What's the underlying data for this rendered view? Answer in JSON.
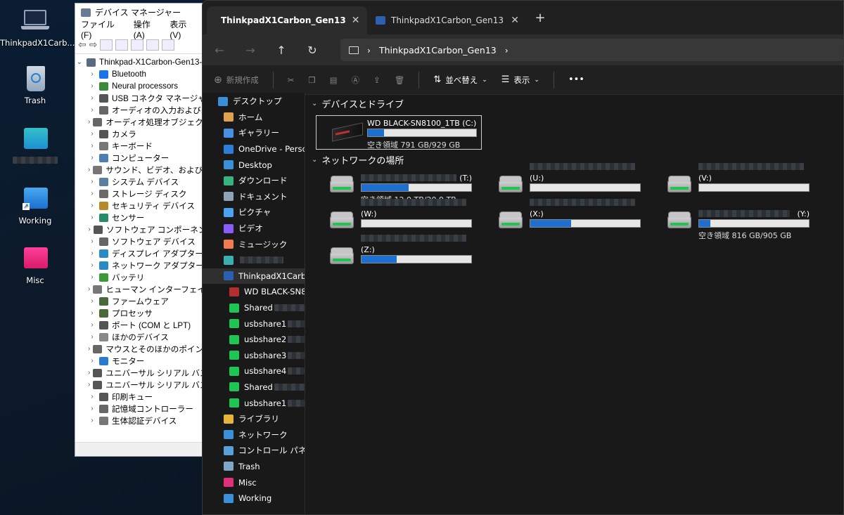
{
  "desktop": {
    "icons": [
      {
        "label": "ThinkpadX1Carb..."
      },
      {
        "label": "Trash"
      },
      {
        "label": ""
      },
      {
        "label": "Working"
      },
      {
        "label": "Misc"
      }
    ]
  },
  "devmgr": {
    "title": "デバイス マネージャー",
    "menu": [
      "ファイル(F)",
      "操作(A)",
      "表示(V)",
      "ヘ"
    ],
    "root": "Thinkpad-X1Carbon-Gen13-",
    "items": [
      "Bluetooth",
      "Neural processors",
      "USB コネクタ マネージャー",
      "オーディオの入力および出",
      "オーディオ処理オブジェクト (A",
      "カメラ",
      "キーボード",
      "コンピューター",
      "サウンド、ビデオ、およびゲーム",
      "システム デバイス",
      "ストレージ ディスク",
      "セキュリティ デバイス",
      "センサー",
      "ソフトウェア コンポーネント",
      "ソフトウェア デバイス",
      "ディスプレイ アダプター",
      "ネットワーク アダプター",
      "バッテリ",
      "ヒューマン インターフェイス デ",
      "ファームウェア",
      "プロセッサ",
      "ポート (COM と LPT)",
      "ほかのデバイス",
      "マウスとそのほかのポインティ",
      "モニター",
      "ユニバーサル シリアル バス コ",
      "ユニバーサル シリアル バス デ",
      "印刷キュー",
      "記憶域コントローラー",
      "生体認証デバイス"
    ]
  },
  "explorer": {
    "tabs": [
      {
        "label": "ThinkpadX1Carbon_Gen13",
        "active": true
      },
      {
        "label": "ThinkpadX1Carbon_Gen13",
        "active": false
      }
    ],
    "path": "ThinkpadX1Carbon_Gen13",
    "commands": {
      "new": "新規作成",
      "sort": "並べ替え",
      "view": "表示",
      "more": "•••"
    },
    "nav": [
      {
        "label": "デスクトップ",
        "icon": "#3b8fd9"
      },
      {
        "label": "ホーム",
        "icon": "#e0a050"
      },
      {
        "label": "ギャラリー",
        "icon": "#4a90e2"
      },
      {
        "label": "OneDrive - Person",
        "icon": "#2b7fd6"
      },
      {
        "label": "Desktop",
        "icon": "#3b8fd9"
      },
      {
        "label": "ダウンロード",
        "icon": "#36b37e"
      },
      {
        "label": "ドキュメント",
        "icon": "#8fa3b8"
      },
      {
        "label": "ピクチャ",
        "icon": "#4aa3f0"
      },
      {
        "label": "ビデオ",
        "icon": "#8b5cf6"
      },
      {
        "label": "ミュージック",
        "icon": "#f07b50"
      },
      {
        "label": "",
        "icon": "#3bb0b0"
      },
      {
        "label": "ThinkpadX1Carbon",
        "icon": "#2c5fb0"
      },
      {
        "label": "WD BLACK-SN81",
        "icon": "#b03030"
      },
      {
        "label": "Shared",
        "icon": "#1fc454"
      },
      {
        "label": "usbshare1",
        "icon": "#1fc454"
      },
      {
        "label": "usbshare2",
        "icon": "#1fc454"
      },
      {
        "label": "usbshare3",
        "icon": "#1fc454"
      },
      {
        "label": "usbshare4",
        "icon": "#1fc454"
      },
      {
        "label": "Shared",
        "icon": "#1fc454"
      },
      {
        "label": "usbshare1",
        "icon": "#1fc454"
      },
      {
        "label": "ライブラリ",
        "icon": "#e8b53a"
      },
      {
        "label": "ネットワーク",
        "icon": "#3b8fd9"
      },
      {
        "label": "コントロール パネル",
        "icon": "#5aa0d8"
      },
      {
        "label": "Trash",
        "icon": "#7fa7c7"
      },
      {
        "label": "Misc",
        "icon": "#e0307a"
      },
      {
        "label": "Working",
        "icon": "#3b8fd9"
      }
    ],
    "section_devices": "デバイスとドライブ",
    "section_network": "ネットワークの場所",
    "local_drive": {
      "name": "WD BLACK-SN8100_1TB (C:)",
      "free": "空き領域 791 GB/929 GB",
      "used_fraction": 0.15
    },
    "network_drives": [
      {
        "letter": "(T:)",
        "used_fraction": 0.43,
        "free": "空き領域 12.0 TB/20.9 TB"
      },
      {
        "letter": "(U:)",
        "used_fraction": 0,
        "free": ""
      },
      {
        "letter": "(V:)",
        "used_fraction": 0,
        "free": ""
      },
      {
        "letter": "(W:)",
        "used_fraction": 0,
        "free": ""
      },
      {
        "letter": "(X:)",
        "used_fraction": 0.37,
        "free": ""
      },
      {
        "letter": "(Y:)",
        "used_fraction": 0.1,
        "free": "空き領域 816 GB/905 GB"
      },
      {
        "letter": "(Z:)",
        "used_fraction": 0.32,
        "free": ""
      }
    ]
  }
}
